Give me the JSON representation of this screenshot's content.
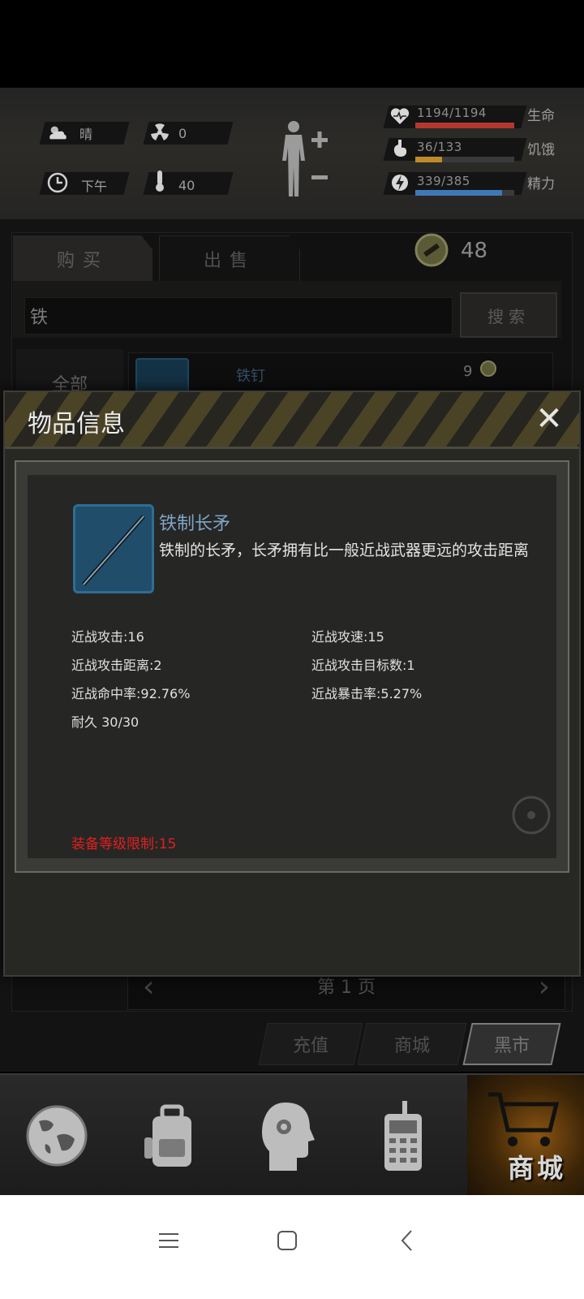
{
  "status": {
    "weather": "晴",
    "radiation": "0",
    "time_of_day": "下午",
    "temperature": "40"
  },
  "vitals": {
    "health": {
      "text": "1194/1194",
      "label": "生命",
      "fraction": 1.0,
      "color": "#b5372f"
    },
    "hunger": {
      "text": "36/133",
      "label": "饥饿",
      "fraction": 0.27,
      "color": "#c08a2a"
    },
    "energy": {
      "text": "339/385",
      "label": "精力",
      "fraction": 0.88,
      "color": "#3e79b6"
    }
  },
  "shop": {
    "tabs": {
      "buy": "购买",
      "sell": "出售"
    },
    "coins": "48",
    "search_value": "铁",
    "search_button": "搜索",
    "category": "全部",
    "first_item": {
      "name": "铁钉",
      "price": "9"
    },
    "pager": "第 1 页",
    "sub_tabs": {
      "recharge": "充值",
      "store": "商城",
      "black_market": "黑市"
    }
  },
  "modal": {
    "title": "物品信息",
    "close": "✕",
    "item_name": "铁制长矛",
    "item_desc": "铁制的长矛，长矛拥有比一般近战武器更远的攻击距离",
    "stats": {
      "melee_attack": "近战攻击:16",
      "melee_speed": "近战攻速:15",
      "melee_range": "近战攻击距离:2",
      "melee_targets": "近战攻击目标数:1",
      "melee_hit_rate": "近战命中率:92.76%",
      "melee_crit_rate": "近战暴击率:5.27%",
      "durability": "耐久 30/30"
    },
    "level_requirement": "装备等级限制:15"
  },
  "bottom_nav": {
    "active_label": "商城",
    "items": [
      "globe-icon",
      "backpack-icon",
      "brain-gear-icon",
      "radio-icon",
      "cart-icon"
    ]
  }
}
